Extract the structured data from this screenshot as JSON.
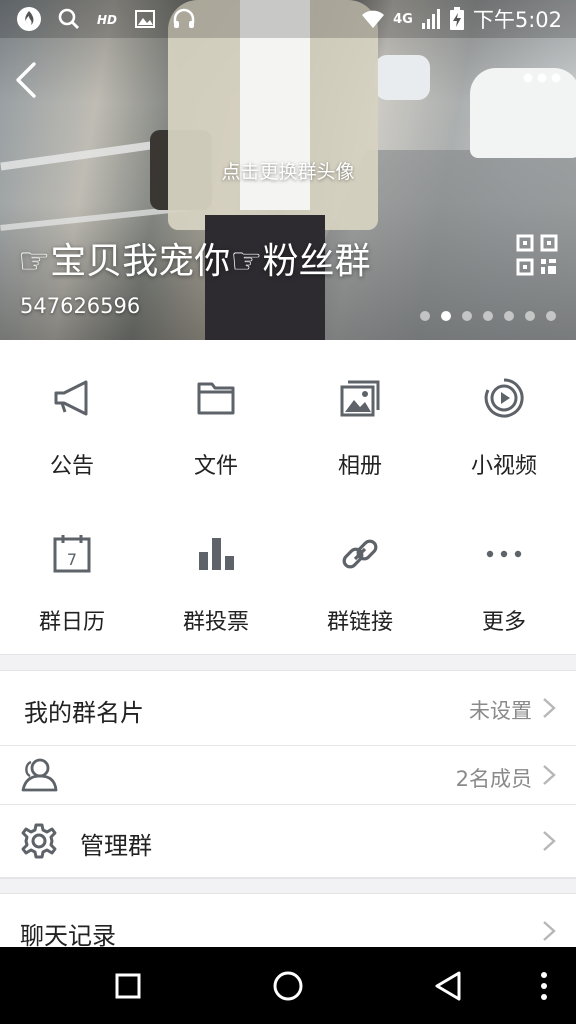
{
  "status_bar": {
    "network": "4G",
    "time": "下午5:02",
    "left_icons": [
      "qq-flame-icon",
      "search-icon",
      "hd-icon",
      "image-icon",
      "headset-icon"
    ]
  },
  "header": {
    "change_avatar_hint": "点击更换群头像",
    "group_name": "☞宝贝我宠你☞粉丝群",
    "group_id": "547626596",
    "page_dots": 7,
    "active_dot": 1
  },
  "grid": [
    {
      "label": "公告",
      "icon": "megaphone-icon"
    },
    {
      "label": "文件",
      "icon": "folder-icon"
    },
    {
      "label": "相册",
      "icon": "photo-album-icon"
    },
    {
      "label": "小视频",
      "icon": "video-play-icon"
    },
    {
      "label": "群日历",
      "icon": "calendar-icon"
    },
    {
      "label": "群投票",
      "icon": "bar-chart-icon"
    },
    {
      "label": "群链接",
      "icon": "link-icon"
    },
    {
      "label": "更多",
      "icon": "more-dots-icon"
    }
  ],
  "calendar_day": "7",
  "list": {
    "card_title": "我的群名片",
    "card_value": "未设置",
    "members_value": "2名成员",
    "manage_title": "管理群",
    "chat_history_title": "聊天记录"
  },
  "colors": {
    "icon_gray": "#5d6369",
    "separator": "#f2f2f4",
    "value_gray": "#8a8a8a"
  }
}
